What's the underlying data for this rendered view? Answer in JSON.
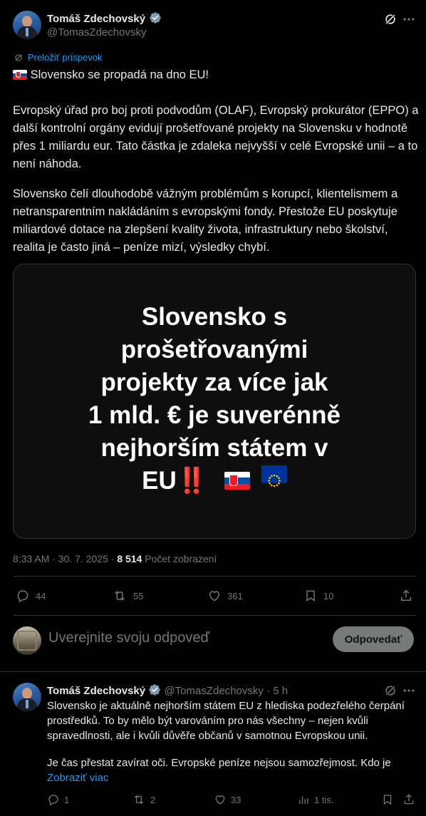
{
  "tweet": {
    "author_name": "Tomáš Zdechovský",
    "author_handle": "@TomasZdechovsky",
    "translate_label": "Preložiť príspevok",
    "headline": "Slovensko se propadá na dno EU!",
    "paragraph1": "Evropský úřad pro boj proti podvodům (OLAF), Evropský prokurátor (EPPO) a další kontrolní orgány evidují prošetřované projekty na Slovensku v hodnotě přes 1 miliardu eur. Tato částka je zdaleka nejvyšší v celé Evropské unii – a to není náhoda.",
    "paragraph2": "Slovensko čelí dlouhodobě vážným problémům s korupcí, klientelismem a netransparentním nakládáním s evropskými fondy. Přestože EU poskytuje miliardové dotace na zlepšení kvality života, infrastruktury nebo školství, realita je často jiná – peníze mizí, výsledky chybí.",
    "media_lines": [
      "Slovensko s",
      "prošetřovanými",
      "projekty za více jak",
      "1 mld. € je suverénně",
      "nejhorším státem v",
      "EU"
    ],
    "media_emoji": "‼️",
    "time": "8:33 AM · 30. 7. 2025 ·",
    "views_count": "8 514",
    "views_label": "Počet zobrazení",
    "stats": {
      "replies": "44",
      "reposts": "55",
      "likes": "361",
      "bookmarks": "10"
    }
  },
  "composer": {
    "placeholder": "Uverejnite svoju odpoveď",
    "reply_button": "Odpovedať"
  },
  "reply": {
    "author_name": "Tomáš Zdechovský",
    "author_handle": "@TomasZdechovsky",
    "time_ago": "· 5 h",
    "paragraph1": "Slovensko je aktuálně nejhorším státem EU z hlediska podezřelého čerpání prostředků. To by mělo být varováním pro nás všechny – nejen kvůli spravedlnosti, ale i kvůli důvěře občanů v samotnou Evropskou unii.",
    "paragraph2": "Je čas přestat zavírat oči. Evropské peníze nejsou samozřejmost. Kdo je",
    "show_more": "Zobraziť viac",
    "stats": {
      "replies": "1",
      "reposts": "2",
      "likes": "33",
      "views": "1 tis."
    }
  },
  "colors": {
    "accent": "#1d9bf0",
    "background": "#000000",
    "muted": "#71767b",
    "divider": "#2f3336"
  },
  "icons": [
    "verified-badge-icon",
    "grok-icon",
    "more-icon",
    "translate-icon",
    "reply-icon",
    "repost-icon",
    "like-icon",
    "bookmark-icon",
    "share-icon",
    "views-icon"
  ]
}
